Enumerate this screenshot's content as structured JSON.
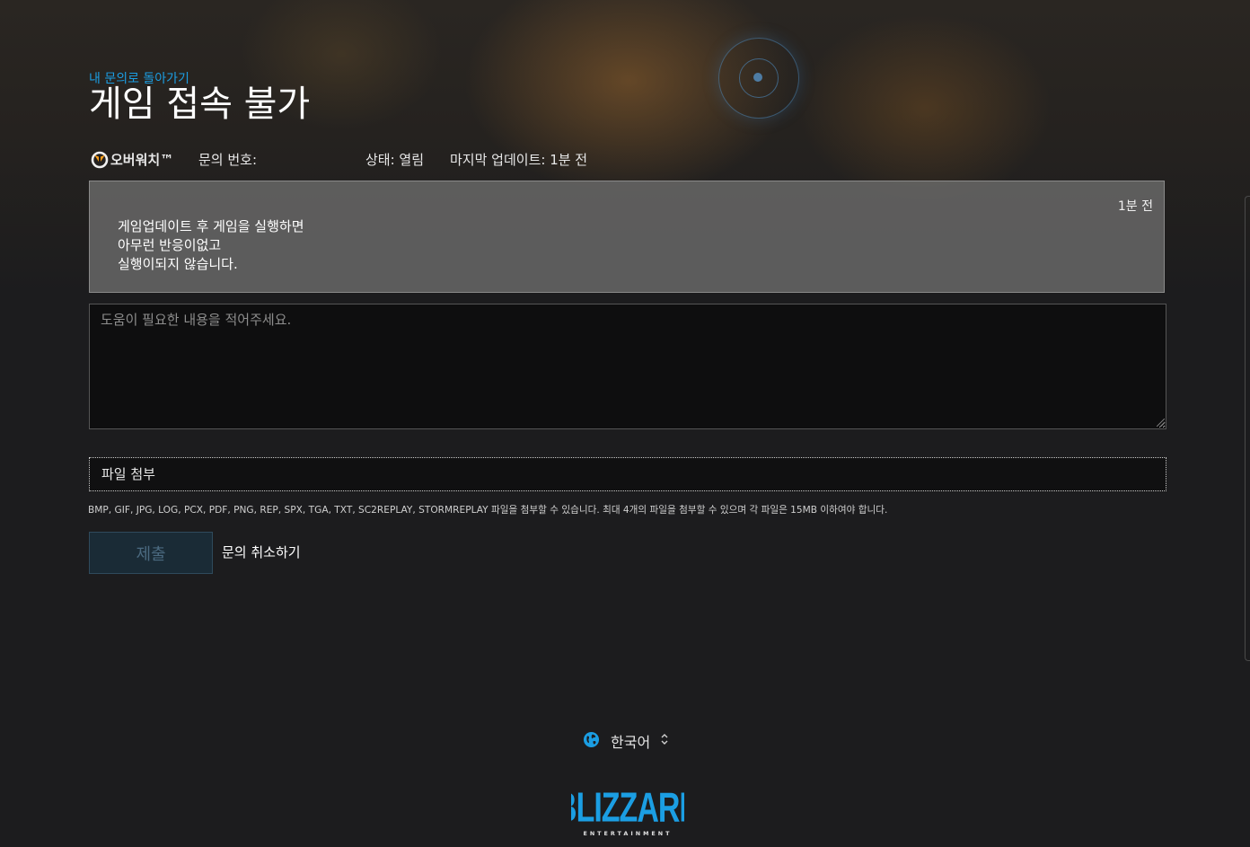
{
  "header": {
    "back_link": "내 문의로 돌아가기",
    "title": "게임 접속 불가"
  },
  "ticket_meta": {
    "game": "오버워치™",
    "ticket_number_label": "문의 번호:",
    "status": "상태: 열림",
    "last_update": "마지막 업데이트: 1분 전"
  },
  "message": {
    "time": "1분 전",
    "lines": [
      "게임업데이트 후 게임을 실행하면",
      "아무런 반응이없고",
      "실행이되지 않습니다."
    ]
  },
  "reply": {
    "placeholder": "도움이 필요한 내용을 적어주세요.",
    "value": ""
  },
  "attachment": {
    "label": "파일 첨부",
    "help": "BMP, GIF, JPG, LOG, PCX, PDF, PNG, REP, SPX, TGA, TXT, SC2REPLAY, STORMREPLAY 파일을 첨부할 수 있습니다. 최대 4개의 파일을 첨부할 수 있으며 각 파일은 15MB 이하여야 합니다."
  },
  "actions": {
    "submit": "제출",
    "cancel": "문의 취소하기"
  },
  "footer": {
    "language": "한국어",
    "logo_text": "BLIZZARD",
    "logo_subtext": "ENTERTAINMENT"
  },
  "colors": {
    "accent": "#1b9ee3",
    "background": "#1c1c1e",
    "message_box": "#6e6e6e",
    "submit_disabled": "#1a2b36"
  },
  "icons": {
    "game": "overwatch-logo-icon",
    "language": "globe-icon",
    "language_toggle": "chevron-updown-icon"
  }
}
